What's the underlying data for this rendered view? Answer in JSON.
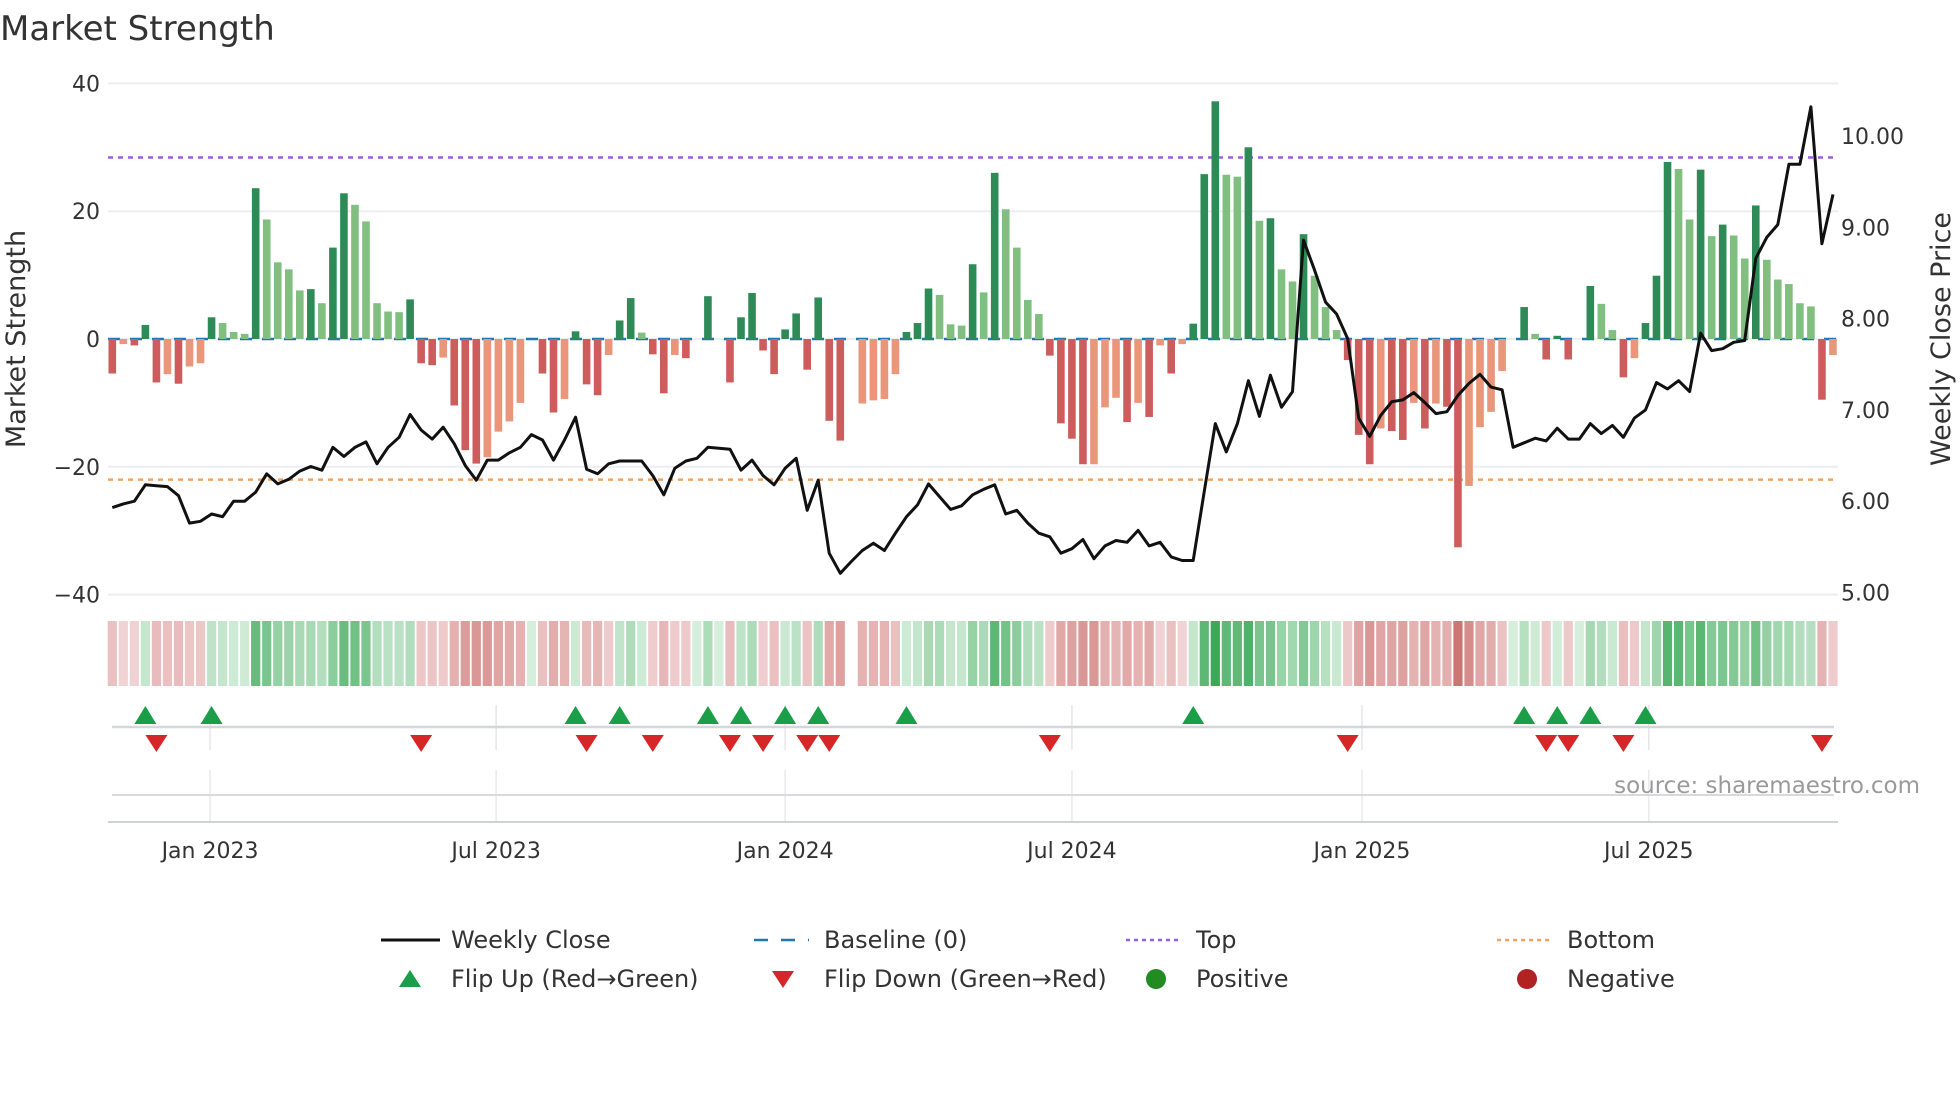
{
  "chart_data": {
    "type": "bar",
    "title": "Market Strength",
    "ylabel": "Market Strength",
    "y2label": "Weekly Close Price",
    "ylim": [
      -40,
      40
    ],
    "y2lim": [
      5.0,
      10.5
    ],
    "grid": true,
    "legend_placement": "bottom-center",
    "y_ticks": [
      {
        "v": 40,
        "label": "40"
      },
      {
        "v": 20,
        "label": "20"
      },
      {
        "v": 0,
        "label": "0"
      },
      {
        "v": -20,
        "label": "−20"
      },
      {
        "v": -40,
        "label": "−40"
      }
    ],
    "y2_ticks": [
      {
        "v": 10,
        "label": "10.00"
      },
      {
        "v": 9,
        "label": "9.00"
      },
      {
        "v": 8,
        "label": "8.00"
      },
      {
        "v": 7,
        "label": "7.00"
      },
      {
        "v": 6,
        "label": "6.00"
      },
      {
        "v": 5,
        "label": "5.00"
      }
    ],
    "x_ticks": [
      {
        "week": 8.86,
        "label": "Jan 2023"
      },
      {
        "week": 34.8,
        "label": "Jul 2023"
      },
      {
        "week": 61.0,
        "label": "Jan 2024"
      },
      {
        "week": 87.0,
        "label": "Jul 2024"
      },
      {
        "week": 113.3,
        "label": "Jan 2025"
      },
      {
        "week": 139.3,
        "label": "Jul 2025"
      }
    ],
    "top_level": 28.4,
    "bottom_level": -22.0,
    "strength": [
      -5.4,
      -0.8,
      -1.0,
      2.2,
      -6.8,
      -5.5,
      -7.0,
      -4.3,
      -3.8,
      3.4,
      2.5,
      1.1,
      0.8,
      23.6,
      18.7,
      12.0,
      10.9,
      7.6,
      7.8,
      5.6,
      14.3,
      22.8,
      21.0,
      18.4,
      5.6,
      4.3,
      4.2,
      6.2,
      -3.8,
      -4.1,
      -2.9,
      -10.4,
      -17.4,
      -19.5,
      -18.5,
      -14.5,
      -12.9,
      -10.0,
      0,
      -5.4,
      -11.5,
      -9.4,
      1.2,
      -7.1,
      -8.8,
      -2.5,
      2.9,
      6.4,
      1.0,
      -2.4,
      -8.5,
      -2.5,
      -3.0,
      0,
      6.7,
      0,
      -6.8,
      3.4,
      7.2,
      -1.8,
      -5.5,
      1.5,
      4.0,
      -4.8,
      6.5,
      -12.8,
      -15.9,
      null,
      -10.1,
      -9.6,
      -9.4,
      -5.5,
      1.1,
      2.5,
      7.9,
      6.9,
      2.3,
      2.1,
      11.7,
      7.3,
      26.0,
      20.3,
      14.3,
      6.1,
      3.9,
      -2.6,
      -13.2,
      -15.6,
      -19.6,
      -19.6,
      -10.7,
      -9.2,
      -13.0,
      -10.0,
      -12.2,
      -1.0,
      -5.4,
      -0.8,
      2.4,
      25.8,
      37.2,
      25.7,
      25.4,
      30.0,
      18.5,
      18.9,
      10.9,
      9.0,
      16.4,
      9.9,
      5.0,
      1.4,
      -3.3,
      -15.0,
      -19.6,
      -14.0,
      -14.4,
      -15.8,
      -10.0,
      -14.0,
      -10.1,
      -10.6,
      -32.6,
      -23.0,
      -13.8,
      -11.4,
      -5.0,
      0,
      5.0,
      0.8,
      -3.2,
      0.5,
      -3.2,
      0,
      8.3,
      5.5,
      1.4,
      -6.0,
      -3.0,
      2.5,
      9.9,
      27.7,
      26.6,
      18.7,
      26.5,
      16.1,
      17.9,
      16.2,
      12.6,
      20.9,
      12.4,
      9.3,
      8.6,
      5.6,
      5.1,
      -9.5,
      -2.5
    ],
    "weekly_close": [
      5.93,
      5.97,
      6.0,
      6.18,
      6.17,
      6.16,
      6.06,
      5.76,
      5.78,
      5.86,
      5.83,
      6.0,
      6.0,
      6.1,
      6.3,
      6.19,
      6.24,
      6.33,
      6.38,
      6.34,
      6.59,
      6.49,
      6.59,
      6.65,
      6.41,
      6.59,
      6.7,
      6.95,
      6.78,
      6.68,
      6.81,
      6.63,
      6.39,
      6.23,
      6.45,
      6.45,
      6.53,
      6.59,
      6.73,
      6.67,
      6.45,
      6.67,
      6.92,
      6.35,
      6.3,
      6.41,
      6.44,
      6.44,
      6.44,
      6.28,
      6.07,
      6.36,
      6.44,
      6.47,
      6.59,
      6.58,
      6.57,
      6.34,
      6.45,
      6.28,
      6.18,
      6.36,
      6.47,
      5.9,
      6.23,
      5.43,
      5.21,
      5.34,
      5.46,
      5.54,
      5.46,
      5.65,
      5.83,
      5.96,
      6.19,
      6.05,
      5.91,
      5.95,
      6.07,
      6.13,
      6.18,
      5.86,
      5.9,
      5.76,
      5.65,
      5.61,
      5.43,
      5.48,
      5.58,
      5.37,
      5.51,
      5.57,
      5.55,
      5.68,
      5.51,
      5.55,
      5.39,
      5.35,
      5.35,
      6.11,
      6.85,
      6.54,
      6.85,
      7.32,
      6.93,
      7.38,
      7.03,
      7.2,
      8.86,
      8.53,
      8.18,
      8.05,
      7.78,
      6.91,
      6.71,
      6.94,
      7.09,
      7.11,
      7.19,
      7.08,
      6.96,
      6.98,
      7.16,
      7.29,
      7.39,
      7.25,
      7.22,
      6.59,
      6.64,
      6.69,
      6.66,
      6.8,
      6.68,
      6.68,
      6.85,
      6.74,
      6.83,
      6.7,
      6.91,
      7.0,
      7.3,
      7.23,
      7.32,
      7.2,
      7.84,
      7.65,
      7.67,
      7.74,
      7.76,
      8.66,
      8.89,
      9.03,
      9.69,
      9.69,
      10.32,
      8.82,
      9.36
    ],
    "flip_up_weeks": [
      3,
      9,
      42,
      46,
      54,
      57,
      61,
      64,
      72,
      98,
      128,
      131,
      134,
      139
    ],
    "flip_down_weeks": [
      4,
      28,
      43,
      49,
      56,
      59,
      63,
      65,
      85,
      112,
      130,
      132,
      137,
      155
    ],
    "legend": [
      {
        "label": "Weekly Close",
        "kind": "line",
        "color": "#111111"
      },
      {
        "label": "Baseline (0)",
        "kind": "dash",
        "color": "#1f77b4"
      },
      {
        "label": "Top",
        "kind": "dot",
        "color": "#9b5de5"
      },
      {
        "label": "Bottom",
        "kind": "dot",
        "color": "#f4a261"
      },
      {
        "label": "Flip Up (Red→Green)",
        "kind": "up",
        "color": "#1a9e48"
      },
      {
        "label": "Flip Down (Green→Red)",
        "kind": "down",
        "color": "#d62728"
      },
      {
        "label": "Positive",
        "kind": "circle",
        "color": "#228b22"
      },
      {
        "label": "Negative",
        "kind": "circle",
        "color": "#b22222"
      }
    ],
    "source": "source: sharemaestro.com"
  },
  "colors": {
    "pos_dark": "#2e8b57",
    "pos_light": "#80bf80",
    "neg_dark": "#cd5c5c",
    "neg_light": "#e9967a",
    "baseline": "#1f77b4",
    "top": "#9b5de5",
    "bottom": "#f4a261",
    "price": "#111111"
  }
}
